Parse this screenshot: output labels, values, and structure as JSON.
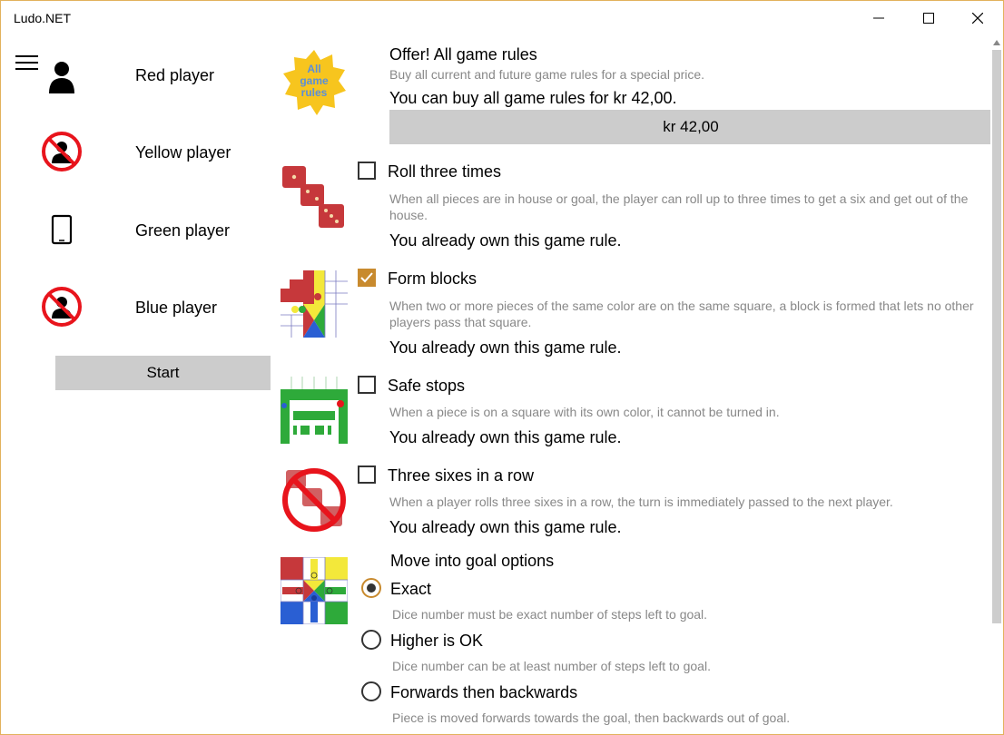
{
  "window": {
    "title": "Ludo.NET"
  },
  "players": [
    {
      "label": "Red player",
      "icon": "person-icon"
    },
    {
      "label": "Yellow player",
      "icon": "no-player-icon"
    },
    {
      "label": "Green player",
      "icon": "tablet-icon"
    },
    {
      "label": "Blue player",
      "icon": "no-player-icon"
    }
  ],
  "start_label": "Start",
  "offer": {
    "badge": "All game rules",
    "title": "Offer! All game rules",
    "subtitle": "Buy all current and future game rules for a special price.",
    "price_text": "You can buy all game rules for kr 42,00.",
    "price_button": "kr 42,00"
  },
  "rules": [
    {
      "title": "Roll three times",
      "checked": false,
      "description": "When all pieces are in house or goal, the player can roll up to three times to get a six and get out of the house.",
      "status": "You already own this game rule."
    },
    {
      "title": "Form blocks",
      "checked": true,
      "description": "When two or more pieces of the same color are on the same square, a block is formed that lets no other players pass that square.",
      "status": "You already own this game rule."
    },
    {
      "title": "Safe stops",
      "checked": false,
      "description": "When a piece is on a square with its own color, it cannot be turned in.",
      "status": "You already own this game rule."
    },
    {
      "title": "Three sixes in a row",
      "checked": false,
      "description": "When a player rolls three sixes in a row, the turn is immediately passed to the next player.",
      "status": "You already own this game rule."
    }
  ],
  "goal_options": {
    "title": "Move into goal options",
    "options": [
      {
        "label": "Exact",
        "description": "Dice number must be exact number of steps left to goal.",
        "selected": true
      },
      {
        "label": "Higher is OK",
        "description": "Dice number can be at least number of steps left to goal.",
        "selected": false
      },
      {
        "label": "Forwards then backwards",
        "description": "Piece is moved forwards towards the goal, then backwards out of goal.",
        "selected": false
      }
    ]
  },
  "colors": {
    "accent": "#c88a2e",
    "button_gray": "#cccccc",
    "description_gray": "#888888",
    "badge_yellow": "#f7c51e",
    "badge_text": "#5b8fd8"
  }
}
